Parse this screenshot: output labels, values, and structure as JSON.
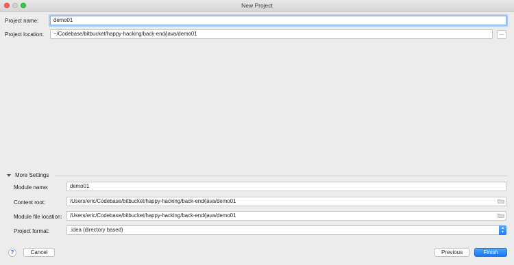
{
  "window": {
    "title": "New Project"
  },
  "project": {
    "name_label": "Project name:",
    "name_value": "demo01",
    "location_label": "Project location:",
    "location_value": "~/Codebase/bitbucket/happy-hacking/back-end/java/demo01",
    "browse_label": "..."
  },
  "more_settings": {
    "toggle_label": "More Settings",
    "module_name_label": "Module name:",
    "module_name_value": "demo01",
    "content_root_label": "Content root:",
    "content_root_value": "/Users/eric/Codebase/bitbucket/happy-hacking/back-end/java/demo01",
    "module_file_location_label": "Module file location:",
    "module_file_location_value": "/Users/eric/Codebase/bitbucket/happy-hacking/back-end/java/demo01",
    "project_format_label": "Project format:",
    "project_format_value": ".idea (directory based)"
  },
  "footer": {
    "help_label": "?",
    "cancel_label": "Cancel",
    "previous_label": "Previous",
    "finish_label": "Finish"
  },
  "colors": {
    "accent": "#1878ee",
    "focus_ring": "#a9cdf3",
    "window_bg": "#ececec"
  },
  "icons": {
    "browse": "ellipsis",
    "folder": "folder-icon",
    "close": "close-traffic-light",
    "minimize": "minimize-traffic-light",
    "maximize": "maximize-traffic-light"
  }
}
